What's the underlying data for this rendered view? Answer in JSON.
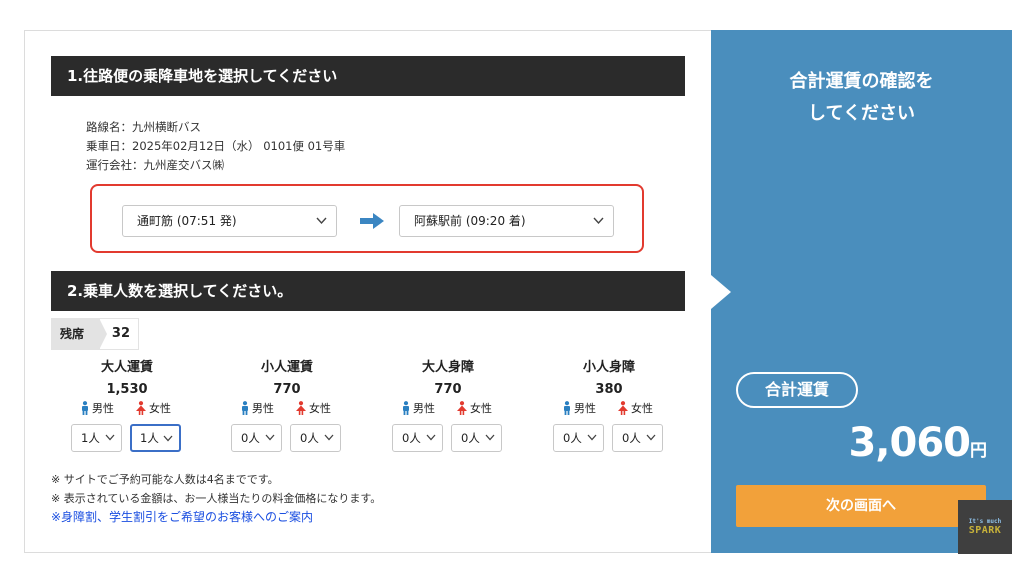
{
  "section1": {
    "title": "1.往路便の乗降車地を選択してください"
  },
  "route": {
    "line": "路線名：九州横断バス",
    "date": "乗車日：2025年02月12日（水） 0101便 01号車",
    "operator": "運行会社：九州産交バス㈱",
    "from": "通町筋 (07:51 発)",
    "to": "阿蘇駅前 (09:20 着)",
    "arrow_icon": "right-arrow-icon",
    "highlight_color": "#e23a2f"
  },
  "section2": {
    "title": "2.乗車人数を選択してください。"
  },
  "seats": {
    "label": "残席",
    "count": "32"
  },
  "fares": [
    {
      "title": "大人運賃",
      "price": "1,530",
      "male_label": "男性",
      "female_label": "女性",
      "male_count": "1人",
      "female_count": "1人"
    },
    {
      "title": "小人運賃",
      "price": "770",
      "male_label": "男性",
      "female_label": "女性",
      "male_count": "0人",
      "female_count": "0人"
    },
    {
      "title": "大人身障",
      "price": "770",
      "male_label": "男性",
      "female_label": "女性",
      "male_count": "0人",
      "female_count": "0人"
    },
    {
      "title": "小人身障",
      "price": "380",
      "male_label": "男性",
      "female_label": "女性",
      "male_count": "0人",
      "female_count": "0人"
    }
  ],
  "notes": {
    "line1": "※ サイトでご予約可能な人数は4名までです。",
    "line2": "※ 表示されている金額は、お一人様当たりの料金価格になります。",
    "link": "※身障割、学生割引をご希望のお客様へのご案内"
  },
  "summary": {
    "title_line1": "合計運賃の確認を",
    "title_line2": "してください",
    "total_label": "合計運賃",
    "total_amount": "3,060",
    "currency": "円",
    "next_button": "次の画面へ",
    "panel_color": "#4a8ebd",
    "button_color": "#f2a13a"
  },
  "watermark": {
    "small": "It's much",
    "big": "SPARK"
  },
  "icons": {
    "male": "male-person-icon",
    "female": "female-person-icon",
    "chevron": "chevron-down-icon"
  },
  "colors": {
    "male": "#2a7fc1",
    "female": "#e23a2f",
    "header": "#2b2b2b",
    "link": "#1a4ee0"
  }
}
